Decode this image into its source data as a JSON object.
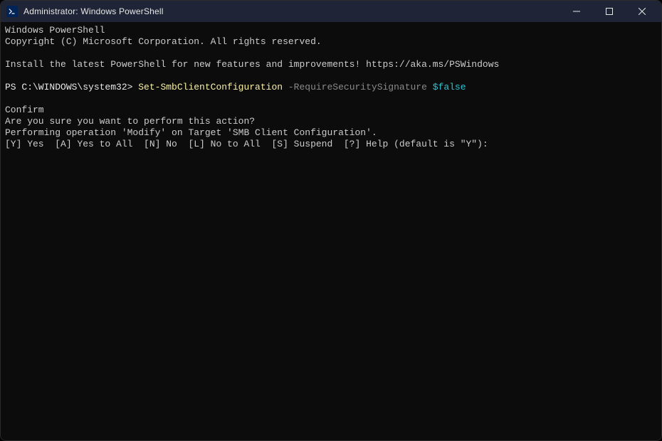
{
  "titlebar": {
    "title": "Administrator: Windows PowerShell"
  },
  "terminal": {
    "line1": "Windows PowerShell",
    "line2": "Copyright (C) Microsoft Corporation. All rights reserved.",
    "line3": "Install the latest PowerShell for new features and improvements! https://aka.ms/PSWindows",
    "prompt": "PS C:\\WINDOWS\\system32> ",
    "command": "Set-SmbClientConfiguration",
    "param": " -RequireSecuritySignature ",
    "value": "$false",
    "confirm_header": "Confirm",
    "confirm_q": "Are you sure you want to perform this action?",
    "confirm_op": "Performing operation 'Modify' on Target 'SMB Client Configuration'.",
    "confirm_choices": "[Y] Yes  [A] Yes to All  [N] No  [L] No to All  [S] Suspend  [?] Help (default is \"Y\"):"
  }
}
